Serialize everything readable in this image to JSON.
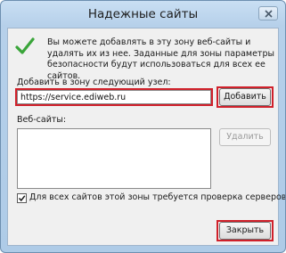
{
  "window": {
    "title": "Надежные сайты",
    "close_symbol": "✕"
  },
  "info": {
    "icon": "green-checkmark-icon",
    "text": "Вы можете добавлять в эту зону веб-сайты и удалять их из нее. Заданные для зоны параметры безопасности будут использоваться для всех ее сайтов."
  },
  "add_zone": {
    "label": "Добавить в зону следующий узел:",
    "value": "https://service.ediweb.ru",
    "add_button": "Добавить"
  },
  "sites": {
    "label": "Веб-сайты:",
    "items": [],
    "remove_button": "Удалить"
  },
  "verification": {
    "checked": true,
    "label": "Для всех сайтов этой зоны требуется проверка серверов (https:)"
  },
  "footer": {
    "close_button": "Закрыть"
  },
  "colors": {
    "highlight": "#d0202a",
    "check_green": "#3aa53a",
    "title_bar": "#b6d0ea"
  }
}
